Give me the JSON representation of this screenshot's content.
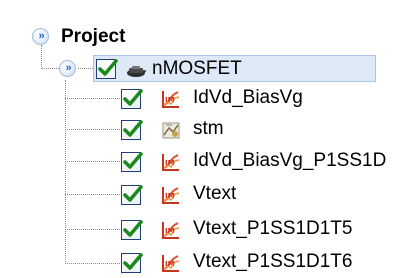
{
  "tree": {
    "root": {
      "label": "Project",
      "icon": "expand-double-chevron-icon"
    },
    "device": {
      "label": "nMOSFET",
      "icon": "mosfet-device-icon",
      "checked": true
    },
    "children": [
      {
        "label": "IdVd_BiasVg",
        "icon": "simulation-tool-icon",
        "checked": true
      },
      {
        "label": "stm",
        "icon": "structure-tool-icon",
        "checked": true
      },
      {
        "label": "IdVd_BiasVg_P1SS1D",
        "icon": "simulation-tool-icon",
        "checked": true
      },
      {
        "label": "Vtext",
        "icon": "simulation-tool-icon",
        "checked": true
      },
      {
        "label": "Vtext_P1SS1D1T5",
        "icon": "simulation-tool-icon",
        "checked": true
      },
      {
        "label": "Vtext_P1SS1D1T6",
        "icon": "simulation-tool-icon",
        "checked": true
      }
    ],
    "colors": {
      "selection": "#dde9f7",
      "check": "#1a8a1a",
      "expander": "#2a63c6",
      "tool_icon": "#c8351c"
    }
  }
}
